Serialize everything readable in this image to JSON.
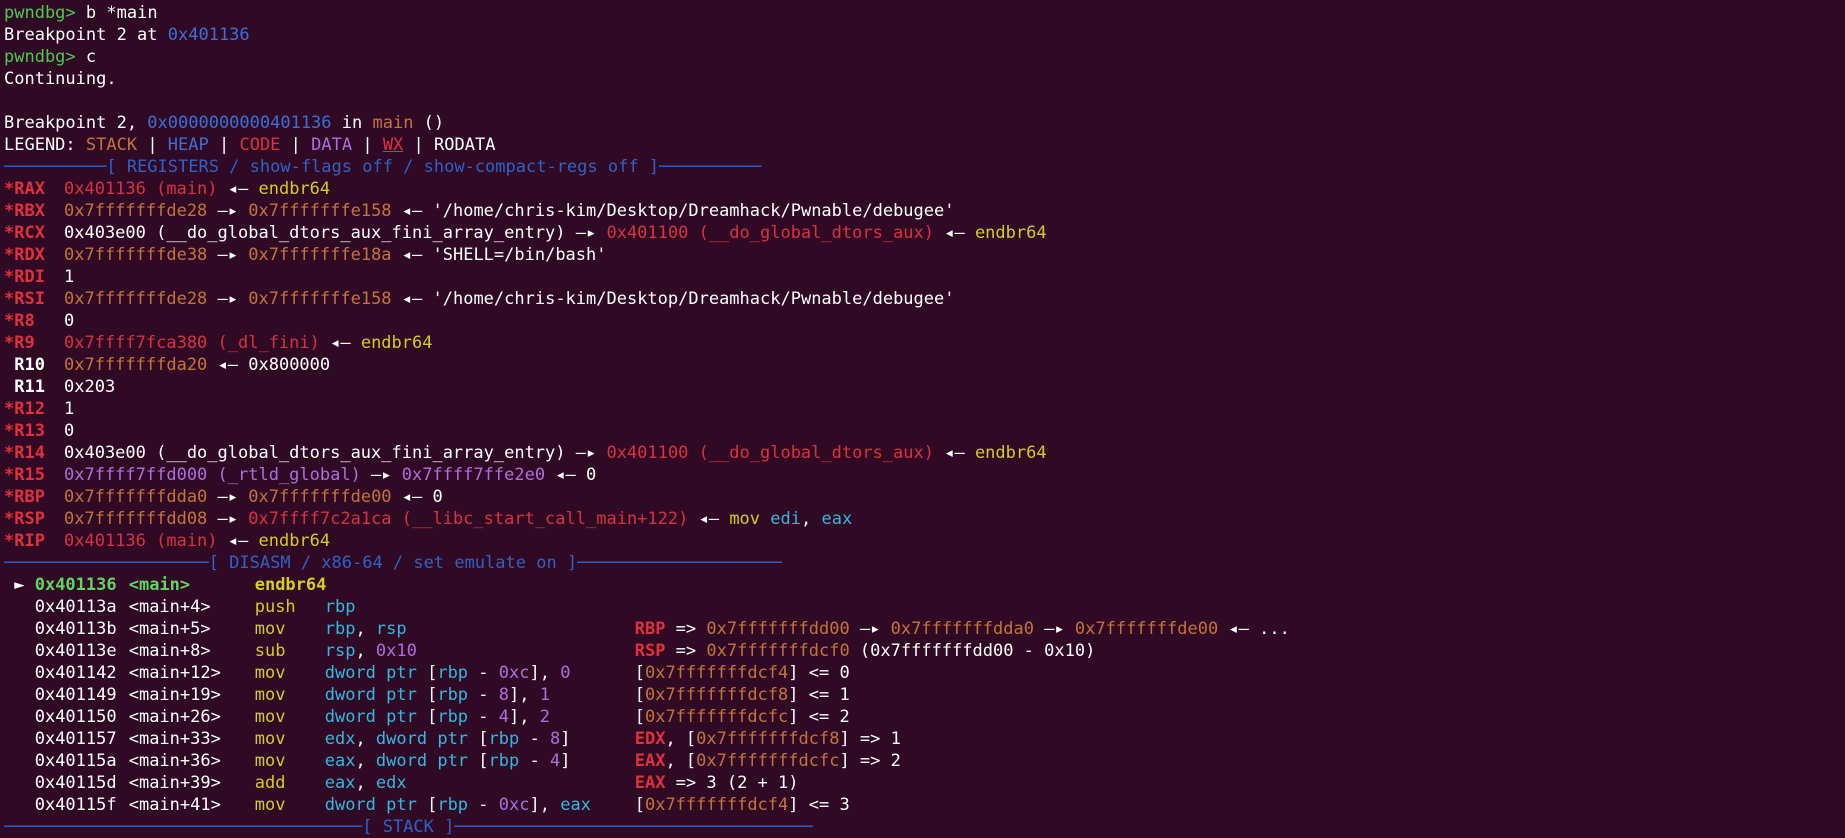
{
  "prompt": "pwndbg>",
  "cmd1": "b *main",
  "bp_set": {
    "prefix": "Breakpoint 2 at ",
    "addr": "0x401136"
  },
  "cmd2": "c",
  "continuing": "Continuing.",
  "bp_hit": {
    "prefix": "Breakpoint 2, ",
    "addr": "0x0000000000401136",
    "mid": " in ",
    "func": "main",
    "suffix": " ()"
  },
  "legend": {
    "label": "LEGEND: ",
    "stack": "STACK",
    "heap": "HEAP",
    "code": "CODE",
    "data": "DATA",
    "wx": "WX",
    "rodata": "RODATA",
    "sep": " | "
  },
  "reg_header": "[ REGISTERS / show-flags off / show-compact-regs off ]",
  "regs": [
    {
      "name": "*RAX",
      "c": "rb",
      "parts": [
        [
          "0x401136 (main)",
          "r"
        ],
        [
          " ◂— ",
          "w"
        ],
        [
          "endbr64",
          "y"
        ]
      ]
    },
    {
      "name": "*RBX",
      "c": "rb",
      "parts": [
        [
          "0x7fffffffde28",
          "o"
        ],
        [
          " —▸ ",
          "w"
        ],
        [
          "0x7fffffffe158",
          "o"
        ],
        [
          " ◂— ",
          "w"
        ],
        [
          "'/home/chris-kim/Desktop/Dreamhack/Pwnable/debugee'",
          "w"
        ]
      ]
    },
    {
      "name": "*RCX",
      "c": "rb",
      "parts": [
        [
          "0x403e00 (__do_global_dtors_aux_fini_array_entry)",
          "w"
        ],
        [
          " —▸ ",
          "w"
        ],
        [
          "0x401100 (__do_global_dtors_aux)",
          "r"
        ],
        [
          " ◂— ",
          "w"
        ],
        [
          "endbr64",
          "y"
        ]
      ]
    },
    {
      "name": "*RDX",
      "c": "rb",
      "parts": [
        [
          "0x7fffffffde38",
          "o"
        ],
        [
          " —▸ ",
          "w"
        ],
        [
          "0x7fffffffe18a",
          "o"
        ],
        [
          " ◂— ",
          "w"
        ],
        [
          "'SHELL=/bin/bash'",
          "w"
        ]
      ]
    },
    {
      "name": "*RDI",
      "c": "rb",
      "parts": [
        [
          "1",
          "w"
        ]
      ]
    },
    {
      "name": "*RSI",
      "c": "rb",
      "parts": [
        [
          "0x7fffffffde28",
          "o"
        ],
        [
          " —▸ ",
          "w"
        ],
        [
          "0x7fffffffe158",
          "o"
        ],
        [
          " ◂— ",
          "w"
        ],
        [
          "'/home/chris-kim/Desktop/Dreamhack/Pwnable/debugee'",
          "w"
        ]
      ]
    },
    {
      "name": "*R8",
      "c": "rb",
      "parts": [
        [
          "0",
          "w"
        ]
      ]
    },
    {
      "name": "*R9",
      "c": "rb",
      "parts": [
        [
          "0x7ffff7fca380 (_dl_fini)",
          "r"
        ],
        [
          " ◂— ",
          "w"
        ],
        [
          "endbr64",
          "y"
        ]
      ]
    },
    {
      "name": " R10",
      "c": "wb",
      "parts": [
        [
          "0x7fffffffda20",
          "o"
        ],
        [
          " ◂— ",
          "w"
        ],
        [
          "0x800000",
          "w"
        ]
      ]
    },
    {
      "name": " R11",
      "c": "wb",
      "parts": [
        [
          "0x203",
          "w"
        ]
      ]
    },
    {
      "name": "*R12",
      "c": "rb",
      "parts": [
        [
          "1",
          "w"
        ]
      ]
    },
    {
      "name": "*R13",
      "c": "rb",
      "parts": [
        [
          "0",
          "w"
        ]
      ]
    },
    {
      "name": "*R14",
      "c": "rb",
      "parts": [
        [
          "0x403e00 (__do_global_dtors_aux_fini_array_entry)",
          "w"
        ],
        [
          " —▸ ",
          "w"
        ],
        [
          "0x401100 (__do_global_dtors_aux)",
          "r"
        ],
        [
          " ◂— ",
          "w"
        ],
        [
          "endbr64",
          "y"
        ]
      ]
    },
    {
      "name": "*R15",
      "c": "rb",
      "parts": [
        [
          "0x7ffff7ffd000 (_rtld_global)",
          "p"
        ],
        [
          " —▸ ",
          "w"
        ],
        [
          "0x7ffff7ffe2e0",
          "p"
        ],
        [
          " ◂— ",
          "w"
        ],
        [
          "0",
          "w"
        ]
      ]
    },
    {
      "name": "*RBP",
      "c": "rb",
      "parts": [
        [
          "0x7fffffffdda0",
          "o"
        ],
        [
          " —▸ ",
          "w"
        ],
        [
          "0x7fffffffde00",
          "o"
        ],
        [
          " ◂— ",
          "w"
        ],
        [
          "0",
          "w"
        ]
      ]
    },
    {
      "name": "*RSP",
      "c": "rb",
      "parts": [
        [
          "0x7fffffffdd08",
          "o"
        ],
        [
          " —▸ ",
          "w"
        ],
        [
          "0x7ffff7c2a1ca (__libc_start_call_main+122)",
          "r"
        ],
        [
          " ◂— ",
          "w"
        ],
        [
          "mov ",
          "y"
        ],
        [
          "edi",
          "c"
        ],
        [
          ", ",
          "w"
        ],
        [
          "eax",
          "c"
        ]
      ]
    },
    {
      "name": "*RIP",
      "c": "rb",
      "parts": [
        [
          "0x401136 (main)",
          "r"
        ],
        [
          " ◂— ",
          "w"
        ],
        [
          "endbr64",
          "y"
        ]
      ]
    }
  ],
  "disasm_header": "[ DISASM / x86-64 / set emulate on ]",
  "disasm": [
    {
      "cur": true,
      "addr": "0x401136",
      "sym": "<main>",
      "mn": "endbr64",
      "ops": [],
      "cmt": []
    },
    {
      "cur": false,
      "addr": "0x40113a",
      "sym": "<main+4>",
      "mn": "push",
      "ops": [
        [
          "rbp",
          "c"
        ]
      ],
      "cmt": []
    },
    {
      "cur": false,
      "addr": "0x40113b",
      "sym": "<main+5>",
      "mn": "mov",
      "ops": [
        [
          "rbp",
          "c"
        ],
        [
          ", ",
          "w"
        ],
        [
          "rsp",
          "c"
        ]
      ],
      "cmt": [
        [
          "RBP",
          "rb"
        ],
        [
          " => ",
          "w"
        ],
        [
          "0x7fffffffdd00",
          "o"
        ],
        [
          " —▸ ",
          "w"
        ],
        [
          "0x7fffffffdda0",
          "o"
        ],
        [
          " —▸ ",
          "w"
        ],
        [
          "0x7fffffffde00",
          "o"
        ],
        [
          " ◂— ...",
          "w"
        ]
      ]
    },
    {
      "cur": false,
      "addr": "0x40113e",
      "sym": "<main+8>",
      "mn": "sub",
      "ops": [
        [
          "rsp",
          "c"
        ],
        [
          ", ",
          "w"
        ],
        [
          "0x10",
          "p"
        ]
      ],
      "cmt": [
        [
          "RSP",
          "rb"
        ],
        [
          " => ",
          "w"
        ],
        [
          "0x7fffffffdcf0",
          "o"
        ],
        [
          " (0x7fffffffdd00 - 0x10)",
          "w"
        ]
      ]
    },
    {
      "cur": false,
      "addr": "0x401142",
      "sym": "<main+12>",
      "mn": "mov",
      "ops": [
        [
          "dword ptr ",
          "c"
        ],
        [
          "[",
          "w"
        ],
        [
          "rbp",
          "c"
        ],
        [
          " - ",
          "w"
        ],
        [
          "0xc",
          "p"
        ],
        [
          "], ",
          "w"
        ],
        [
          "0",
          "p"
        ]
      ],
      "cmt": [
        [
          "[",
          "w"
        ],
        [
          "0x7fffffffdcf4",
          "o"
        ],
        [
          "] <= 0",
          "w"
        ]
      ]
    },
    {
      "cur": false,
      "addr": "0x401149",
      "sym": "<main+19>",
      "mn": "mov",
      "ops": [
        [
          "dword ptr ",
          "c"
        ],
        [
          "[",
          "w"
        ],
        [
          "rbp",
          "c"
        ],
        [
          " - ",
          "w"
        ],
        [
          "8",
          "p"
        ],
        [
          "], ",
          "w"
        ],
        [
          "1",
          "p"
        ]
      ],
      "cmt": [
        [
          "[",
          "w"
        ],
        [
          "0x7fffffffdcf8",
          "o"
        ],
        [
          "] <= 1",
          "w"
        ]
      ]
    },
    {
      "cur": false,
      "addr": "0x401150",
      "sym": "<main+26>",
      "mn": "mov",
      "ops": [
        [
          "dword ptr ",
          "c"
        ],
        [
          "[",
          "w"
        ],
        [
          "rbp",
          "c"
        ],
        [
          " - ",
          "w"
        ],
        [
          "4",
          "p"
        ],
        [
          "], ",
          "w"
        ],
        [
          "2",
          "p"
        ]
      ],
      "cmt": [
        [
          "[",
          "w"
        ],
        [
          "0x7fffffffdcfc",
          "o"
        ],
        [
          "] <= 2",
          "w"
        ]
      ]
    },
    {
      "cur": false,
      "addr": "0x401157",
      "sym": "<main+33>",
      "mn": "mov",
      "ops": [
        [
          "edx",
          "c"
        ],
        [
          ", ",
          "w"
        ],
        [
          "dword ptr ",
          "c"
        ],
        [
          "[",
          "w"
        ],
        [
          "rbp",
          "c"
        ],
        [
          " - ",
          "w"
        ],
        [
          "8",
          "p"
        ],
        [
          "]",
          "w"
        ]
      ],
      "cmt": [
        [
          "EDX",
          "rb"
        ],
        [
          ", [",
          "w"
        ],
        [
          "0x7fffffffdcf8",
          "o"
        ],
        [
          "] => 1",
          "w"
        ]
      ]
    },
    {
      "cur": false,
      "addr": "0x40115a",
      "sym": "<main+36>",
      "mn": "mov",
      "ops": [
        [
          "eax",
          "c"
        ],
        [
          ", ",
          "w"
        ],
        [
          "dword ptr ",
          "c"
        ],
        [
          "[",
          "w"
        ],
        [
          "rbp",
          "c"
        ],
        [
          " - ",
          "w"
        ],
        [
          "4",
          "p"
        ],
        [
          "]",
          "w"
        ]
      ],
      "cmt": [
        [
          "EAX",
          "rb"
        ],
        [
          ", [",
          "w"
        ],
        [
          "0x7fffffffdcfc",
          "o"
        ],
        [
          "] => 2",
          "w"
        ]
      ]
    },
    {
      "cur": false,
      "addr": "0x40115d",
      "sym": "<main+39>",
      "mn": "add",
      "ops": [
        [
          "eax",
          "c"
        ],
        [
          ", ",
          "w"
        ],
        [
          "edx",
          "c"
        ]
      ],
      "cmt": [
        [
          "EAX",
          "rb"
        ],
        [
          " => 3 (2 + 1)",
          "w"
        ]
      ]
    },
    {
      "cur": false,
      "addr": "0x40115f",
      "sym": "<main+41>",
      "mn": "mov",
      "ops": [
        [
          "dword ptr ",
          "c"
        ],
        [
          "[",
          "w"
        ],
        [
          "rbp",
          "c"
        ],
        [
          " - ",
          "w"
        ],
        [
          "0xc",
          "p"
        ],
        [
          "], ",
          "w"
        ],
        [
          "eax",
          "c"
        ]
      ],
      "cmt": [
        [
          "[",
          "w"
        ],
        [
          "0x7fffffffdcf4",
          "o"
        ],
        [
          "] <= 3",
          "w"
        ]
      ]
    }
  ],
  "stack_header": "[ STACK ]",
  "cursor_marker": "►"
}
